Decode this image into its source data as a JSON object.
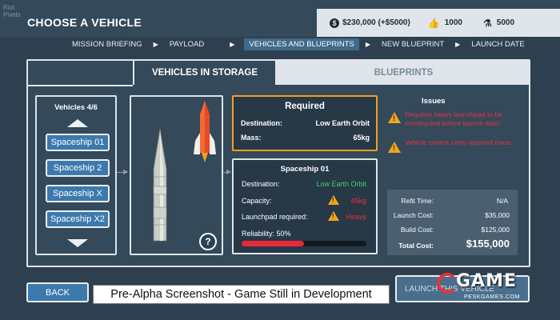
{
  "header": {
    "watermark": "Riot\nPixels",
    "title": "CHOOSE A VEHICLE",
    "resources": {
      "money": "$230,000 (+$5000)",
      "likes": "1000",
      "science": "5000"
    }
  },
  "breadcrumbs": [
    {
      "label": "MISSION BRIEFING"
    },
    {
      "label": "PAYLOAD"
    },
    {
      "label": "VEHICLES AND BLUEPRINTS"
    },
    {
      "label": "NEW BLUEPRINT"
    },
    {
      "label": "LAUNCH DATE"
    }
  ],
  "tabs": {
    "storage": "VEHICLES IN STORAGE",
    "blueprints": "BLUEPRINTS"
  },
  "vehicles": {
    "title": "Vehicles 4/6",
    "items": [
      "Spaceship 01",
      "Spaceship 2",
      "Spaceship X",
      "Spaceship X2"
    ]
  },
  "required": {
    "title": "Required",
    "destination_label": "Destination:",
    "destination_value": "Low Earth Orbit",
    "mass_label": "Mass:",
    "mass_value": "65kg"
  },
  "ship": {
    "title": "Spaceship 01",
    "destination_label": "Destination:",
    "destination_value": "Low Earth Orbit",
    "capacity_label": "Capacity:",
    "capacity_value": "45kg",
    "launchpad_label": "Launchpad required:",
    "launchpad_value": "Heavy",
    "reliability_label": "Reliability: 50%",
    "reliability_fraction": 0.5
  },
  "issues": {
    "title": "Issues",
    "items": [
      "Requires heavy launchpad to be constructed before launch date!",
      "Vehicle cannot carry required mass."
    ]
  },
  "costs": {
    "refit_label": "Refit Time:",
    "refit_value": "N/A",
    "launch_label": "Launch Cost:",
    "launch_value": "$35,000",
    "build_label": "Build Cost:",
    "build_value": "$125,000",
    "total_label": "Total Cost:",
    "total_value": "$155,000"
  },
  "buttons": {
    "back": "BACK",
    "launch": "LAUNCH THIS VEHICLE",
    "help": "?"
  },
  "banner": "Pre-Alpha Screenshot - Game Still in Development",
  "logo": {
    "big": "GAME",
    "small": "PESKGAMES.COM"
  },
  "colors": {
    "accent_blue": "#3d79ad",
    "warning_orange": "#f2a51c",
    "error_red": "#e8323c",
    "ok_green": "#3fd16f"
  }
}
